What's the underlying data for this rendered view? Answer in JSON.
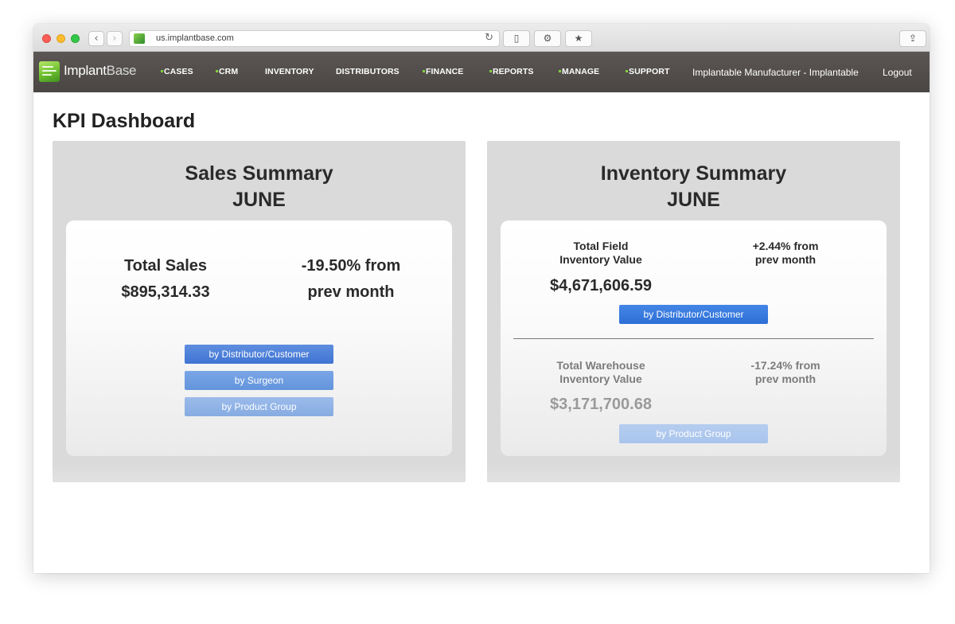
{
  "browser": {
    "url": "us.implantbase.com"
  },
  "navbar": {
    "logo_text_a": "Implant",
    "logo_text_b": "Base",
    "items": [
      "CASES",
      "CRM",
      "INVENTORY",
      "DISTRIBUTORS",
      "FINANCE",
      "REPORTS",
      "MANAGE",
      "SUPPORT"
    ],
    "user": "Implantable Manufacturer - Implantable",
    "logout": "Logout"
  },
  "page": {
    "title": "KPI Dashboard"
  },
  "sales_summary": {
    "title": "Sales Summary",
    "month": "JUNE",
    "total_label": "Total Sales",
    "total_value": "$895,314.33",
    "change_line1": "-19.50% from",
    "change_line2": "prev month",
    "buttons": [
      "by Distributor/Customer",
      "by Surgeon",
      "by Product Group"
    ]
  },
  "inventory_summary": {
    "title": "Inventory Summary",
    "month": "JUNE",
    "field": {
      "label_line1": "Total Field",
      "label_line2": "Inventory Value",
      "value": "$4,671,606.59",
      "change_line1": "+2.44% from",
      "change_line2": "prev month",
      "button": "by Distributor/Customer"
    },
    "warehouse": {
      "label_line1": "Total Warehouse",
      "label_line2": "Inventory Value",
      "value": "$3,171,700.68",
      "change_line1": "-17.24% from",
      "change_line2": "prev month",
      "button": "by Product Group"
    }
  },
  "colors": {
    "navbar": "#4f4a48",
    "accent_green": "#7dd23a",
    "button_blue": "#3f74d2",
    "panel_bg": "#dadada"
  }
}
